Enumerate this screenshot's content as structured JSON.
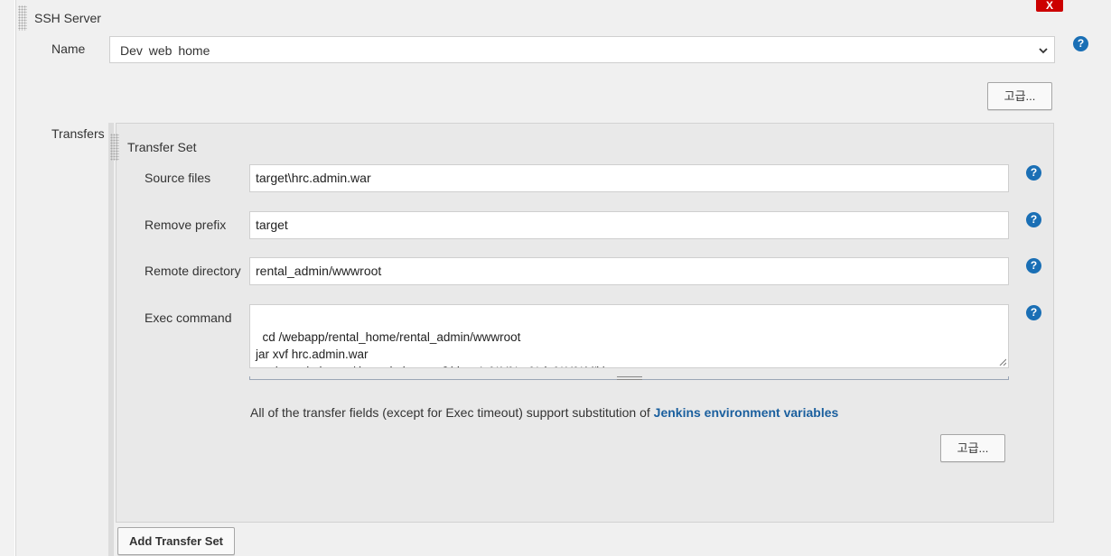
{
  "ssh_server": {
    "section_title": "SSH Server",
    "delete_label": "X",
    "name_label": "Name",
    "name_value": "Dev web home",
    "advanced_label": "고급..."
  },
  "transfers": {
    "label": "Transfers",
    "set_title": "Transfer Set",
    "source_files_label": "Source files",
    "source_files_value": "target\\hrc.admin.war",
    "remove_prefix_label": "Remove prefix",
    "remove_prefix_value": "target",
    "remote_directory_label": "Remote directory",
    "remote_directory_value": "rental_admin/wwwroot",
    "exec_command_label": "Exec command",
    "exec_command_value": "cd /webapp/rental_home/rental_admin/wwwroot\njar xvf hrc.admin.war\nmv hrc.admin.war/ hrc.admin.war_$(date '+%Y%m%d_%H%M')/",
    "info_text": "All of the transfer fields (except for Exec timeout) support substitution of ",
    "info_link": "Jenkins environment variables",
    "advanced_label": "고급...",
    "add_button": "Add Transfer Set"
  },
  "help_glyph": "?",
  "icons": [
    "help-icon",
    "chevron-down-icon",
    "drag-handle-icon",
    "resize-grip-icon"
  ],
  "colors": {
    "help": "#1a6fb5",
    "delete": "#cc0000",
    "link": "#1a5f9e"
  }
}
